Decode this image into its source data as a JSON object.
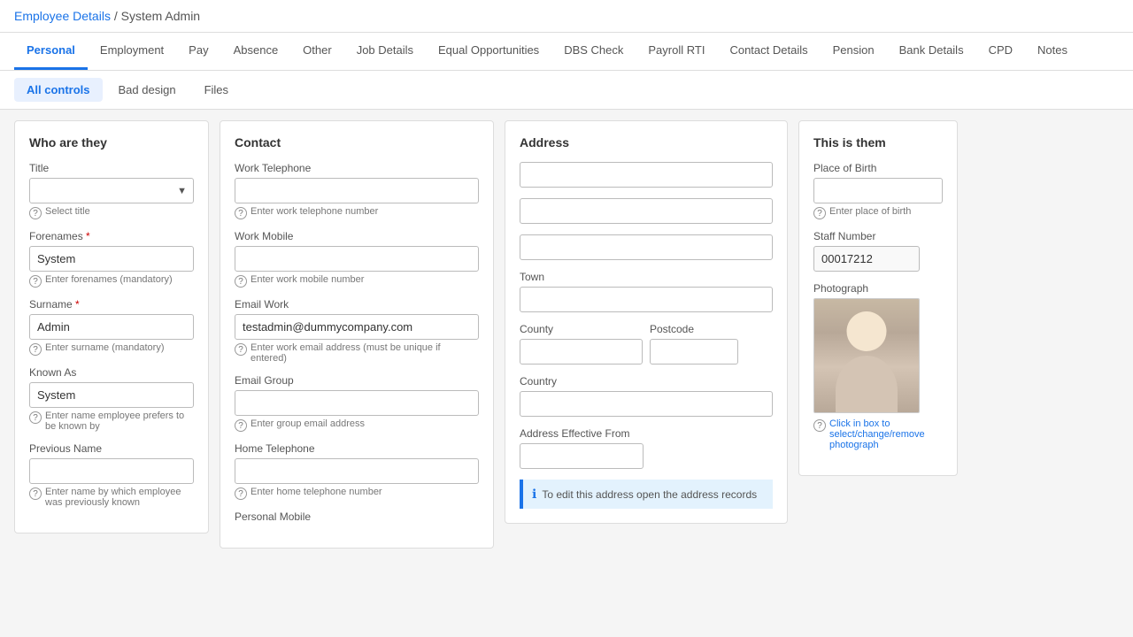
{
  "breadcrumb": {
    "link_text": "Employee Details",
    "separator": "/",
    "current": "System Admin"
  },
  "tabs": [
    {
      "label": "Personal",
      "active": true
    },
    {
      "label": "Employment",
      "active": false
    },
    {
      "label": "Pay",
      "active": false
    },
    {
      "label": "Absence",
      "active": false
    },
    {
      "label": "Other",
      "active": false
    },
    {
      "label": "Job Details",
      "active": false
    },
    {
      "label": "Equal Opportunities",
      "active": false
    },
    {
      "label": "DBS Check",
      "active": false
    },
    {
      "label": "Payroll RTI",
      "active": false
    },
    {
      "label": "Contact Details",
      "active": false
    },
    {
      "label": "Pension",
      "active": false
    },
    {
      "label": "Bank Details",
      "active": false
    },
    {
      "label": "CPD",
      "active": false
    },
    {
      "label": "Notes",
      "active": false
    }
  ],
  "sub_tabs": [
    {
      "label": "All controls",
      "active": true
    },
    {
      "label": "Bad design",
      "active": false
    },
    {
      "label": "Files",
      "active": false
    }
  ],
  "who_are_they": {
    "title": "Who are they",
    "title_label": "Title",
    "title_placeholder": "",
    "title_help": "Select title",
    "forenames_label": "Forenames",
    "forenames_value": "System",
    "forenames_help": "Enter forenames (mandatory)",
    "surname_label": "Surname",
    "surname_value": "Admin",
    "surname_help": "Enter surname (mandatory)",
    "known_as_label": "Known As",
    "known_as_value": "System",
    "known_as_help": "Enter name employee prefers to be known by",
    "previous_name_label": "Previous Name",
    "previous_name_value": "",
    "previous_name_help": "Enter name by which employee was previously known"
  },
  "contact": {
    "title": "Contact",
    "work_telephone_label": "Work Telephone",
    "work_telephone_value": "",
    "work_telephone_help": "Enter work telephone number",
    "work_mobile_label": "Work Mobile",
    "work_mobile_value": "",
    "work_mobile_help": "Enter work mobile number",
    "email_work_label": "Email Work",
    "email_work_value": "testadmin@dummycompany.com",
    "email_work_help": "Enter work email address (must be unique if entered)",
    "email_group_label": "Email Group",
    "email_group_value": "",
    "email_group_help": "Enter group email address",
    "home_telephone_label": "Home Telephone",
    "home_telephone_value": "",
    "home_telephone_help": "Enter home telephone number",
    "personal_mobile_label": "Personal Mobile"
  },
  "address": {
    "title": "Address",
    "line1_value": "",
    "line2_value": "",
    "line3_value": "",
    "town_label": "Town",
    "town_value": "",
    "county_label": "County",
    "county_value": "",
    "postcode_label": "Postcode",
    "postcode_value": "",
    "country_label": "Country",
    "country_value": "",
    "address_effective_from_label": "Address Effective From",
    "address_effective_from_value": "",
    "info_text": "To edit this address open the address records"
  },
  "this_is_them": {
    "title": "This is them",
    "place_of_birth_label": "Place of Birth",
    "place_of_birth_value": "",
    "place_of_birth_help": "Enter place of birth",
    "staff_number_label": "Staff Number",
    "staff_number_value": "00017212",
    "photograph_label": "Photograph",
    "photograph_help": "Click in box to select/change/remove photograph"
  }
}
